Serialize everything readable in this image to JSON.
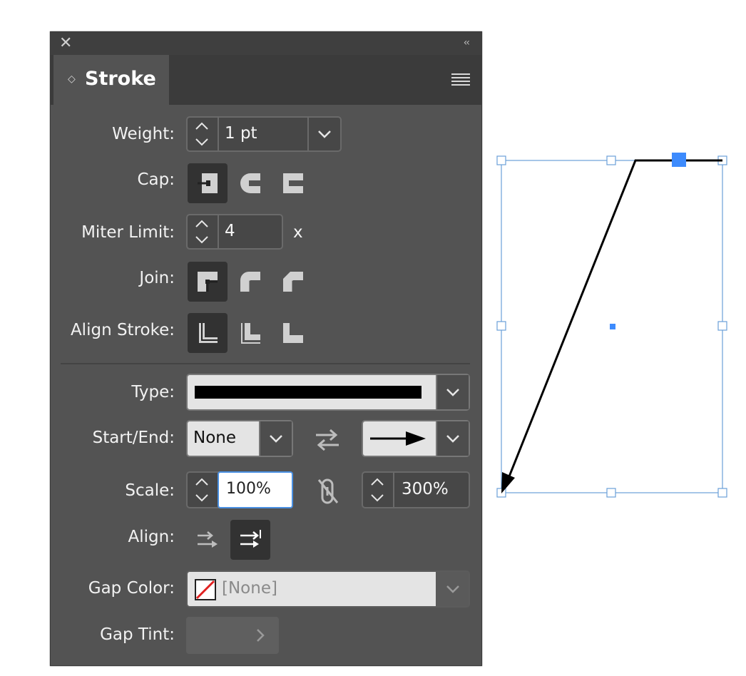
{
  "panel": {
    "close_icon": "close-icon",
    "collapse_glyph": "‹‹",
    "tab_title": "Stroke",
    "tab_arrows": "◇"
  },
  "weight": {
    "label": "Weight:",
    "value": "1 pt"
  },
  "cap": {
    "label": "Cap:",
    "options": [
      "butt-cap",
      "round-cap",
      "projecting-cap"
    ],
    "selected": 0
  },
  "miter": {
    "label": "Miter Limit:",
    "value": "4",
    "unit": "x"
  },
  "join": {
    "label": "Join:",
    "options": [
      "miter-join",
      "round-join",
      "bevel-join"
    ],
    "selected": 0
  },
  "align_stroke": {
    "label": "Align Stroke:",
    "options": [
      "align-center",
      "align-inside",
      "align-outside"
    ],
    "selected": 0
  },
  "type": {
    "label": "Type:",
    "value": "solid"
  },
  "start_end": {
    "label": "Start/End:",
    "start": "None",
    "end": "arrow"
  },
  "scale": {
    "label": "Scale:",
    "start": "100%",
    "end": "300%"
  },
  "align": {
    "label": "Align:",
    "options": [
      "extend-beyond-path",
      "place-at-path-end"
    ],
    "selected": 1
  },
  "gap_color": {
    "label": "Gap Color:",
    "value": "[None]"
  },
  "gap_tint": {
    "label": "Gap Tint:",
    "value": ""
  },
  "colors": {
    "panel_bg": "#535353",
    "selection": "#4a90e2",
    "accent_blue": "#3d8bfd",
    "none_red": "#e02020"
  }
}
